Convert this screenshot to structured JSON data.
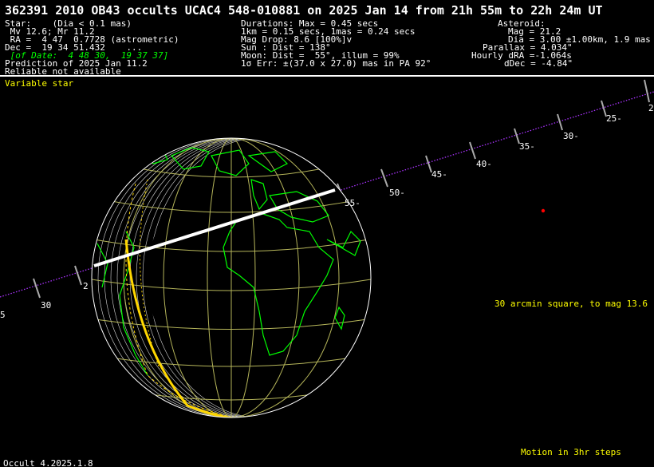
{
  "header": {
    "title": "362391 2010 OB43 occults UCAC4 548-010881 on 2025 Jan 14 from 21h 55m to 22h 24m UT",
    "star": {
      "line1": "Star:    (Dia < 0.1 mas)",
      "line2": " Mv 12.6; Mr 11.2",
      "line3": " RA =  4 47  0.7728 (astrometric)",
      "line4": "Dec =  19 34 51.432    ...",
      "line5": " [of Date:  4 48 30,  19 37 37]",
      "line6": "Prediction of 2025 Jan 11.2",
      "line7": "Reliable not available"
    },
    "event": {
      "line1": "Durations: Max = 0.45 secs",
      "line2": "1km = 0.15 secs, 1mas = 0.24 secs",
      "line3": "Mag Drop: 8.6 [100%]v",
      "line4": "Sun : Dist = 138°",
      "line5": "Moon: Dist =  55°, illum = 99%",
      "line6": "1σ Err: ±(37.0 x 27.0) mas in PA 92°"
    },
    "asteroid": {
      "line1": "Asteroid:",
      "line2": "Mag = 21.2",
      "line3": "Dia = 3.00 ±1.00km, 1.9 mas",
      "line4": "Parallax = 4.034\"",
      "line5": "Hourly dRA =-1.064s",
      "line6": "dDec = -4.84\""
    }
  },
  "notes": {
    "variable_star": "Variable star",
    "field_info": "30 arcmin square, to mag 13.6",
    "motion": "Motion in 3hr steps",
    "version": "Occult 4.2025.1.8"
  },
  "track_ticks": [
    "5",
    "30",
    "2",
    "55-",
    "50-",
    "45-",
    "40-",
    "35-",
    "30-",
    "25-",
    "2"
  ],
  "colors": {
    "background": "#000000",
    "text": "#ffffff",
    "header_date": "#00ff00",
    "note_yellow": "#ffff00",
    "coastline": "#00ff00",
    "graticule": "#b5b55a",
    "path": "#ffffff",
    "track": "#aa33ff",
    "limb": "#ffd700",
    "star_marker": "#ff0000"
  }
}
